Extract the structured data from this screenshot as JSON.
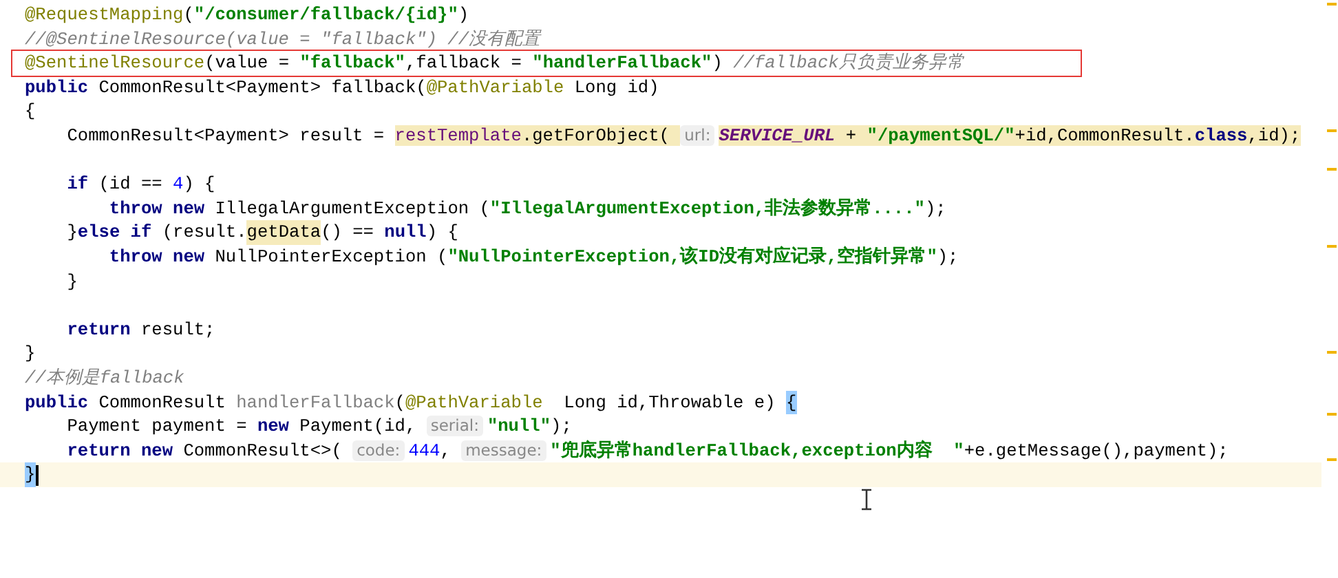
{
  "editor": {
    "lines": [
      {
        "tokens": [
          {
            "kind": "annotation",
            "text": "@RequestMapping"
          },
          {
            "kind": "plain",
            "text": "("
          },
          {
            "kind": "string",
            "text": "\"/consumer/fallback/{id}\""
          },
          {
            "kind": "plain",
            "text": ")"
          }
        ]
      },
      {
        "tokens": [
          {
            "kind": "comment",
            "text": "//@SentinelResource(value = \"fallback\") //没有配置"
          }
        ]
      },
      {
        "boxed": true,
        "tokens": [
          {
            "kind": "annotation",
            "text": "@SentinelResource"
          },
          {
            "kind": "plain",
            "text": "(value = "
          },
          {
            "kind": "string",
            "text": "\"fallback\""
          },
          {
            "kind": "plain",
            "text": ",fallback = "
          },
          {
            "kind": "string",
            "text": "\"handlerFallback\""
          },
          {
            "kind": "plain",
            "text": ") "
          },
          {
            "kind": "comment",
            "text": "//fallback只负责业务异常"
          }
        ]
      },
      {
        "tokens": [
          {
            "kind": "keyword",
            "text": "public"
          },
          {
            "kind": "plain",
            "text": " CommonResult<Payment> fallback("
          },
          {
            "kind": "annotation",
            "text": "@PathVariable"
          },
          {
            "kind": "plain",
            "text": " Long id)"
          }
        ]
      },
      {
        "tokens": [
          {
            "kind": "plain",
            "text": "{"
          }
        ]
      },
      {
        "tokens": [
          {
            "kind": "plain",
            "text": "    CommonResult<Payment> result = "
          },
          {
            "kind": "field",
            "text": "restTemplate",
            "highlighted": true
          },
          {
            "kind": "plain",
            "text": ".getForObject( ",
            "highlighted": true
          },
          {
            "kind": "hint",
            "text": "url:"
          },
          {
            "kind": "constant",
            "text": "SERVICE_URL",
            "highlighted": true
          },
          {
            "kind": "plain",
            "text": " + ",
            "highlighted": true
          },
          {
            "kind": "string",
            "text": "\"/paymentSQL/\"",
            "highlighted": true
          },
          {
            "kind": "plain",
            "text": "+id,CommonResult.",
            "highlighted": true
          },
          {
            "kind": "keyword",
            "text": "class",
            "highlighted": true
          },
          {
            "kind": "plain",
            "text": ",id);",
            "highlighted": true
          }
        ]
      },
      {
        "blank": true
      },
      {
        "tokens": [
          {
            "kind": "keyword",
            "text": "    if"
          },
          {
            "kind": "plain",
            "text": " (id == "
          },
          {
            "kind": "number",
            "text": "4"
          },
          {
            "kind": "plain",
            "text": ") {"
          }
        ]
      },
      {
        "tokens": [
          {
            "kind": "keyword",
            "text": "        throw new"
          },
          {
            "kind": "plain",
            "text": " IllegalArgumentException ("
          },
          {
            "kind": "string",
            "text": "\"IllegalArgumentException,非法参数异常....\""
          },
          {
            "kind": "plain",
            "text": ");"
          }
        ]
      },
      {
        "tokens": [
          {
            "kind": "plain",
            "text": "    }"
          },
          {
            "kind": "keyword",
            "text": "else if"
          },
          {
            "kind": "plain",
            "text": " (result."
          },
          {
            "kind": "plain",
            "text": "getData",
            "highlighted": true
          },
          {
            "kind": "plain",
            "text": "() == "
          },
          {
            "kind": "keyword",
            "text": "null"
          },
          {
            "kind": "plain",
            "text": ") {"
          }
        ]
      },
      {
        "tokens": [
          {
            "kind": "keyword",
            "text": "        throw new"
          },
          {
            "kind": "plain",
            "text": " NullPointerException ("
          },
          {
            "kind": "string",
            "text": "\"NullPointerException,该ID没有对应记录,空指针异常\""
          },
          {
            "kind": "plain",
            "text": ");"
          }
        ]
      },
      {
        "tokens": [
          {
            "kind": "plain",
            "text": "    }"
          }
        ]
      },
      {
        "blank": true
      },
      {
        "tokens": [
          {
            "kind": "keyword",
            "text": "    return"
          },
          {
            "kind": "plain",
            "text": " result;"
          }
        ]
      },
      {
        "tokens": [
          {
            "kind": "plain",
            "text": "}"
          }
        ]
      },
      {
        "tokens": [
          {
            "kind": "comment",
            "text": "//本例是fallback"
          }
        ]
      },
      {
        "tokens": [
          {
            "kind": "keyword",
            "text": "public"
          },
          {
            "kind": "plain",
            "text": " CommonResult "
          },
          {
            "kind": "unused",
            "text": "handlerFallback"
          },
          {
            "kind": "plain",
            "text": "("
          },
          {
            "kind": "annotation",
            "text": "@PathVariable"
          },
          {
            "kind": "plain",
            "text": "  Long id,Throwable e) "
          },
          {
            "kind": "plain",
            "text": "{",
            "brace_matched": true
          }
        ]
      },
      {
        "tokens": [
          {
            "kind": "plain",
            "text": "    Payment payment = "
          },
          {
            "kind": "keyword",
            "text": "new"
          },
          {
            "kind": "plain",
            "text": " Payment(id, "
          },
          {
            "kind": "hint",
            "text": "serial:"
          },
          {
            "kind": "string",
            "text": "\"null\""
          },
          {
            "kind": "plain",
            "text": ");"
          }
        ]
      },
      {
        "tokens": [
          {
            "kind": "keyword",
            "text": "    return new"
          },
          {
            "kind": "plain",
            "text": " CommonResult<>( "
          },
          {
            "kind": "hint",
            "text": "code:"
          },
          {
            "kind": "number",
            "text": "444"
          },
          {
            "kind": "plain",
            "text": ", "
          },
          {
            "kind": "hint",
            "text": "message:"
          },
          {
            "kind": "string",
            "text": "\"兜底异常handlerFallback,exception内容  \""
          },
          {
            "kind": "plain",
            "text": "+e.getMessage(),payment);"
          }
        ]
      },
      {
        "current": true,
        "tokens": [
          {
            "kind": "plain",
            "text": "}",
            "brace_matched": true
          }
        ]
      }
    ]
  }
}
